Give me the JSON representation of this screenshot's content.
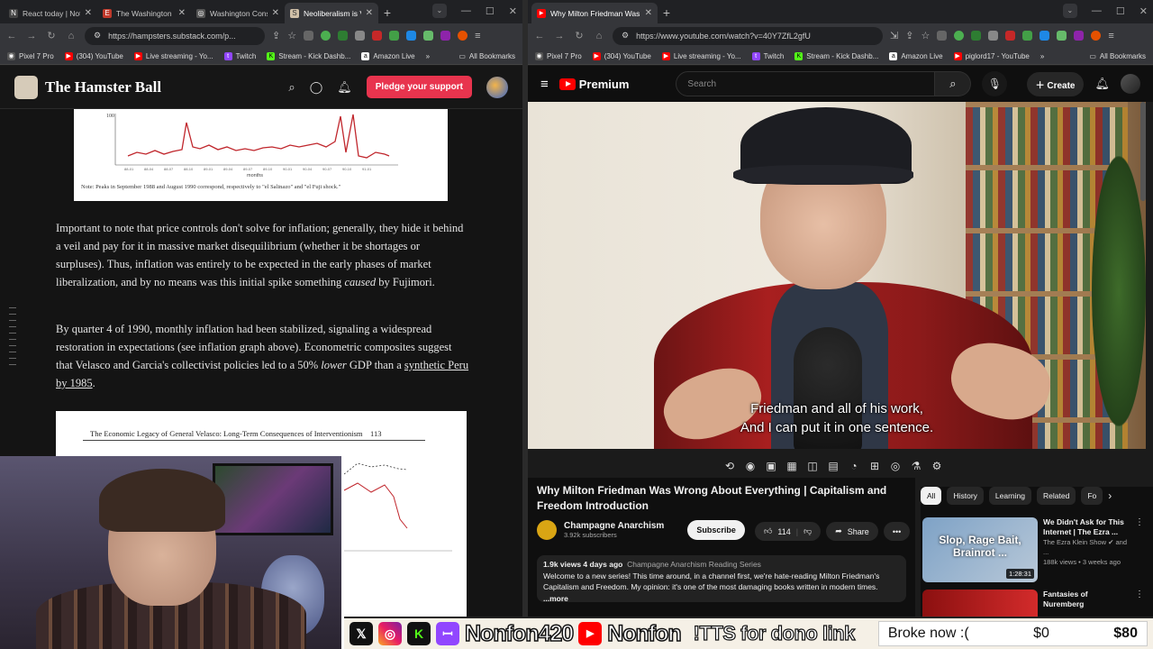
{
  "left_browser": {
    "tabs": [
      {
        "title": "React today | Noti",
        "icon": "N",
        "color": "#444"
      },
      {
        "title": "The Washington c",
        "icon": "E",
        "color": "#c0392b"
      },
      {
        "title": "Washington Cons",
        "icon": "◎",
        "color": "#555"
      },
      {
        "title": "Neoliberalism is V",
        "icon": "S",
        "color": "#d0c0a8",
        "active": true
      }
    ],
    "url": "https://hampsters.substack.com/p...",
    "bookmarks": [
      "Pixel 7 Pro",
      "(304) YouTube",
      "Live streaming - Yo...",
      "Twitch",
      "Stream - Kick Dashb...",
      "Amazon Live"
    ],
    "all_bookmarks": "All Bookmarks"
  },
  "right_browser": {
    "tabs": [
      {
        "title": "Why Milton Friedman Was Wro",
        "icon": "▶",
        "color": "#ff0000",
        "active": true
      }
    ],
    "url": "https://www.youtube.com/watch?v=40Y7ZfL2gfU",
    "bookmarks": [
      "Pixel 7 Pro",
      "(304) YouTube",
      "Live streaming - Yo...",
      "Twitch",
      "Stream - Kick Dashb...",
      "Amazon Live",
      "piglord17 - YouTube"
    ],
    "all_bookmarks": "All Bookmarks"
  },
  "substack": {
    "title": "The Hamster Ball",
    "pledge": "Pledge your support",
    "figure1_note": "Note: Peaks in September 1988 and August 1990 correspond, respectively to \"el Salinazo\" and \"el Fuji shock.\"",
    "figure1_xlabel": "months",
    "figure1_ytick": "100",
    "para1_a": "Important to note that price controls don't solve for inflation; generally, they hide it behind a veil and pay for it in massive market disequilibrium (whether it be shortages or surpluses). Thus, inflation was entirely to be expected in the early phases of market liberalization, and by no means was this initial spike something ",
    "para1_em": "caused",
    "para1_b": " by Fujimori.",
    "para2_a": "By quarter 4 of 1990, monthly inflation had been stabilized, signaling a widespread restoration in expectations (see inflation graph above). Econometric composites suggest that Velasco and Garcia's collectivist policies led to a 50% ",
    "para2_em": "lower",
    "para2_b": " GDP than a ",
    "para2_link": "synthetic Peru by 1985",
    "para2_c": ".",
    "figure2_title": "The Economic Legacy of General Velasco: Long-Term Consequences of Interventionism",
    "figure2_page": "113"
  },
  "youtube": {
    "logo": "Premium",
    "search_placeholder": "Search",
    "create": "Create",
    "subtitle_line1": "Friedman and all of his work,",
    "subtitle_line2": "And I can put it in one sentence.",
    "video_title": "Why Milton Friedman Was Wrong About Everything | Capitalism and Freedom Introduction",
    "channel": "Champagne Anarchism",
    "subs": "3.92k subscribers",
    "subscribe": "Subscribe",
    "likes": "114",
    "share": "Share",
    "desc_meta": "1.9k views  4 days ago",
    "desc_playlist": "Champagne Anarchism Reading Series",
    "desc_text": "Welcome to a new series! This time around, in a channel first, we're hate-reading Milton Friedman's Capitalism and Freedom. My opinion: it's one of the most damaging books written in modern times.",
    "desc_more": "...more",
    "chips": [
      "All",
      "History",
      "Learning",
      "Related",
      "Fo"
    ],
    "recs": [
      {
        "thumb_text": "Slop, Rage Bait, Brainrot ...",
        "duration": "1:28:31",
        "title": "We Didn't Ask for This Internet | The Ezra ...",
        "channel": "The Ezra Klein Show ✔ and ...",
        "meta": "188k views • 3 weeks ago"
      },
      {
        "thumb_text": "",
        "duration": "",
        "title": "Fantasies of Nuremberg",
        "channel": "",
        "meta": ""
      }
    ]
  },
  "overlay": {
    "handle1": "Nonfon420",
    "handle2": "Nonfon",
    "tts": "!TTS for dono link",
    "goal_label": "Broke now :(",
    "goal_current": "$0",
    "goal_target": "$80"
  }
}
